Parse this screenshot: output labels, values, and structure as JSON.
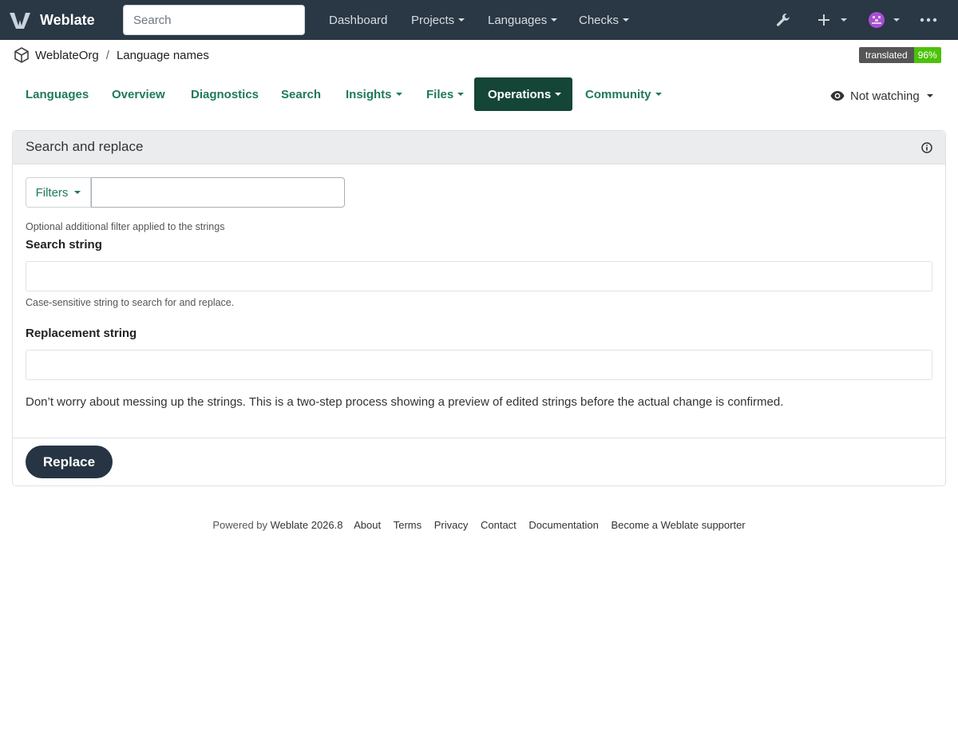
{
  "topbar": {
    "brand": "Weblate",
    "search_placeholder": "Search",
    "nav": [
      "Dashboard",
      "Projects",
      "Languages",
      "Checks"
    ],
    "icons": [
      "wrench-icon",
      "plus-icon",
      "user-avatar",
      "more-icon"
    ]
  },
  "breadcrumb": {
    "project": "WeblateOrg",
    "component": "Language names"
  },
  "badge": {
    "label": "translated",
    "value": "96%",
    "color": "#4cc20b"
  },
  "tabs": {
    "languages": "Languages",
    "overview": "Overview",
    "diagnostics": "Diagnostics",
    "search": "Search",
    "insights": "Insights",
    "files": "Files",
    "operations": "Operations",
    "community": "Community",
    "active": "Operations"
  },
  "watch": {
    "label": "Not watching"
  },
  "panel": {
    "title": "Search and replace",
    "filters_label": "Filters",
    "filter_help": "Optional additional filter applied to the strings",
    "search_label": "Search string",
    "search_help": "Case-sensitive string to search for and replace.",
    "replacement_label": "Replacement string",
    "note": "Don’t worry about messing up the strings. This is a two-step process showing a preview of edited strings before the actual change is confirmed.",
    "replace_button": "Replace"
  },
  "footer": {
    "powered_by": "Powered by",
    "version": "Weblate 2026.8",
    "links": [
      "About",
      "Terms",
      "Privacy",
      "Contact",
      "Documentation",
      "Become a Weblate supporter"
    ]
  },
  "colors": {
    "topbar": "#2a3744",
    "accent": "#1f7a5a",
    "active_tab": "#154537",
    "button_dark": "#263443"
  }
}
